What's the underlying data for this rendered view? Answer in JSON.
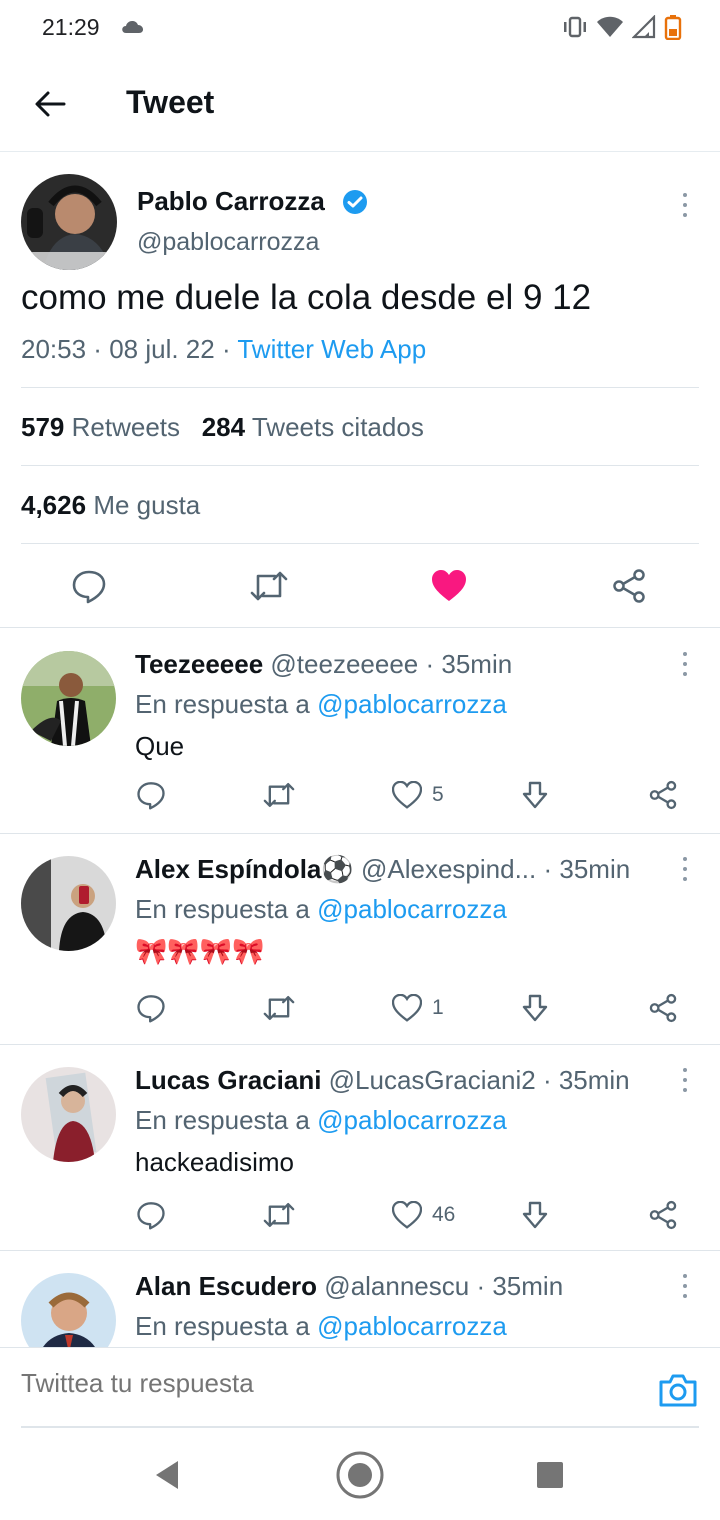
{
  "status_bar": {
    "time": "21:29"
  },
  "header": {
    "title": "Tweet"
  },
  "main_tweet": {
    "name": "Pablo Carrozza",
    "handle": "@pablocarrozza",
    "text": "como me duele la cola desde el 9 12",
    "time": "20:53",
    "date": "08 jul. 22",
    "source": "Twitter Web App",
    "retweets_count": "579",
    "retweets_label": "Retweets",
    "quotes_count": "284",
    "quotes_label": "Tweets citados",
    "likes_count": "4,626",
    "likes_label": "Me gusta"
  },
  "reply_prefix": "En respuesta a",
  "replies": [
    {
      "name": "Teezeeeee",
      "handle": "@teezeeeee",
      "time": "35min",
      "mention": "@pablocarrozza",
      "text": "Que",
      "likes": "5"
    },
    {
      "name": "Alex Espíndola⚽",
      "handle": "@Alexespind...",
      "time": "35min",
      "mention": "@pablocarrozza",
      "text": "🎀🎀🎀🎀",
      "likes": "1"
    },
    {
      "name": "Lucas Graciani",
      "handle": "@LucasGraciani2",
      "time": "35min",
      "mention": "@pablocarrozza",
      "text": "hackeadisimo",
      "likes": "46"
    },
    {
      "name": "Alan Escudero",
      "handle": "@alannescu",
      "time": "35min",
      "mention": "@pablocarrozza",
      "text": "",
      "likes": ""
    }
  ],
  "compose": {
    "placeholder": "Twittea tu respuesta"
  },
  "colors": {
    "accent": "#1d9bf0",
    "like_active": "#f91880",
    "text": "#0f1419",
    "muted": "#536471"
  }
}
